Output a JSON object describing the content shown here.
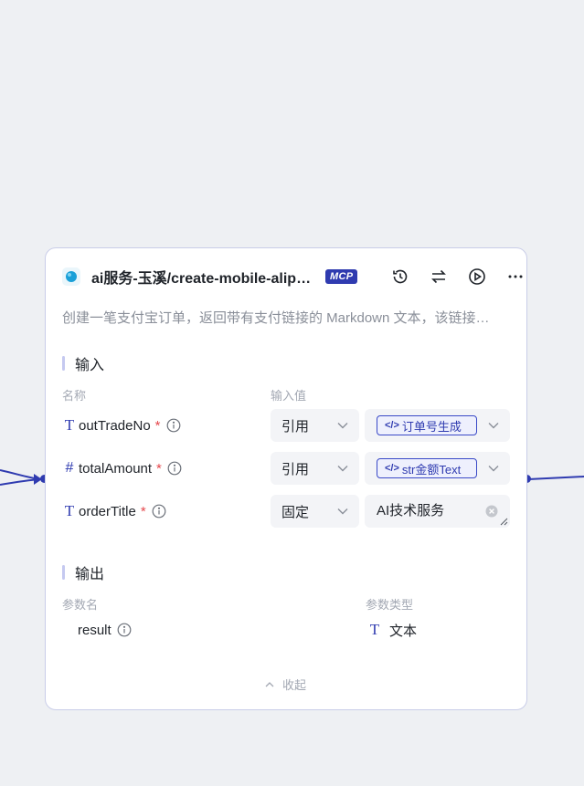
{
  "node": {
    "title": "ai服务-玉溪/create-mobile-alipay-payment",
    "badge": "MCP",
    "description": "创建一笔支付宝订单，返回带有支付链接的 Markdown 文本，该链接可以打开支付宝进行支付",
    "collapse_label": "收起"
  },
  "input": {
    "section_title": "输入",
    "col_name": "名称",
    "col_value": "输入值",
    "params": [
      {
        "type_icon": "T",
        "name": "outTradeNo",
        "mode": "引用",
        "ref": "订单号生成"
      },
      {
        "type_icon": "#",
        "name": "totalAmount",
        "mode": "引用",
        "ref": "str金额Text"
      },
      {
        "type_icon": "T",
        "name": "orderTitle",
        "mode": "固定",
        "value": "AI技术服务"
      }
    ]
  },
  "output": {
    "section_title": "输出",
    "col_name": "参数名",
    "col_type": "参数类型",
    "params": [
      {
        "name": "result",
        "type_icon": "T",
        "type": "文本"
      }
    ]
  },
  "icons": {
    "history": "history-icon",
    "swap": "swap-icon",
    "run": "play-icon",
    "more": "more-icon"
  },
  "colors": {
    "accent": "#2f3bb0",
    "required": "#e5484d",
    "border": "#c9cde8",
    "canvas": "#eef0f3"
  }
}
